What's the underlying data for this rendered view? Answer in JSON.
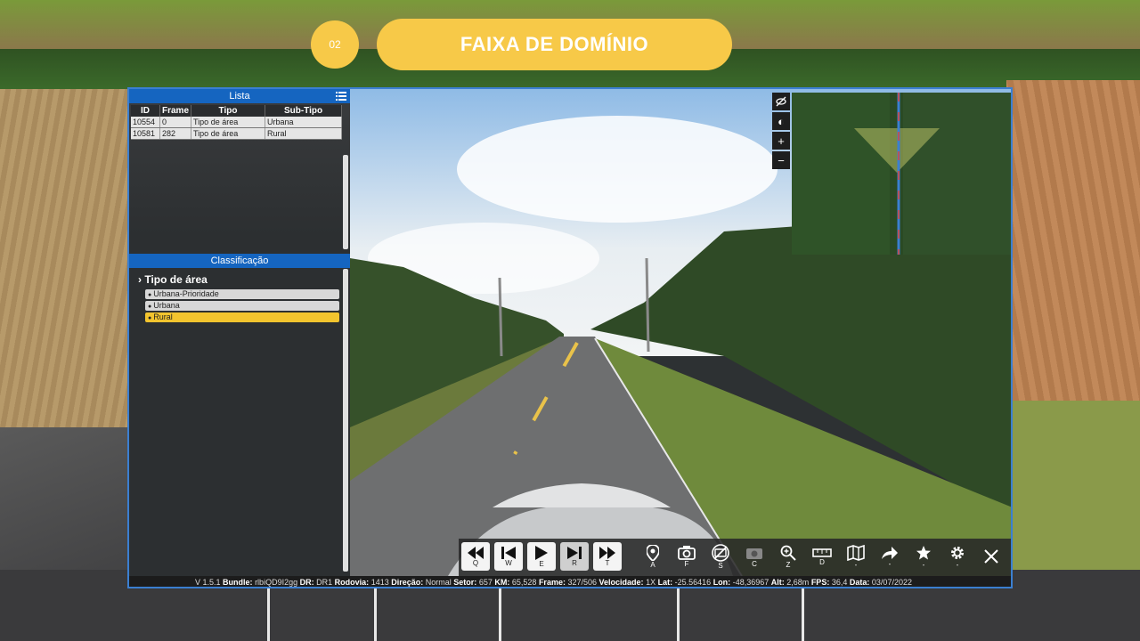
{
  "header": {
    "step": "02",
    "title": "FAIXA DE DOMÍNIO"
  },
  "list_panel": {
    "title": "Lista",
    "columns": [
      "ID",
      "Frame",
      "Tipo",
      "Sub-Tipo"
    ],
    "rows": [
      {
        "id": "10554",
        "frame": "0",
        "tipo": "Tipo de área",
        "subtipo": "Urbana"
      },
      {
        "id": "10581",
        "frame": "282",
        "tipo": "Tipo de área",
        "subtipo": "Rural"
      }
    ]
  },
  "classification_panel": {
    "title": "Classificação",
    "group": "Tipo de área",
    "items": [
      "Urbana-Prioridade",
      "Urbana",
      "Rural"
    ],
    "selected": "Rural"
  },
  "map_tools": [
    "eye-off-icon",
    "contrast-icon",
    "zoom-in-icon",
    "zoom-out-icon"
  ],
  "toolbar": {
    "playback": [
      {
        "name": "rewind",
        "key": "Q"
      },
      {
        "name": "previous",
        "key": "W"
      },
      {
        "name": "play",
        "key": "E"
      },
      {
        "name": "next",
        "key": "R"
      },
      {
        "name": "fast-forward",
        "key": "T"
      }
    ],
    "tools": [
      {
        "name": "location",
        "key": "A"
      },
      {
        "name": "camera",
        "key": "F"
      },
      {
        "name": "camera-off",
        "key": "S"
      },
      {
        "name": "camera-delete",
        "key": "C"
      },
      {
        "name": "zoom",
        "key": "Z"
      },
      {
        "name": "ruler",
        "key": "D"
      },
      {
        "name": "map",
        "key": "-"
      },
      {
        "name": "forward",
        "key": "-"
      },
      {
        "name": "favorite",
        "key": "-"
      },
      {
        "name": "settings",
        "key": "-"
      },
      {
        "name": "close",
        "key": ""
      }
    ]
  },
  "status": {
    "version": "V 1.5.1",
    "bundle": "rlbiQD9I2gg",
    "dr": "DR1",
    "rodovia": "1413",
    "direcao": "Normal",
    "setor": "657",
    "km": "65,528",
    "frame": "327/506",
    "velocidade": "1X",
    "lat": "-25.56416",
    "lon": "-48,36967",
    "alt": "2,68m",
    "fps": "36,4",
    "data": "03/07/2022"
  },
  "colors": {
    "accent": "#f7c948",
    "window_border": "#3b7fd1",
    "panel_header": "#1565c0",
    "selected": "#f2c42e"
  }
}
